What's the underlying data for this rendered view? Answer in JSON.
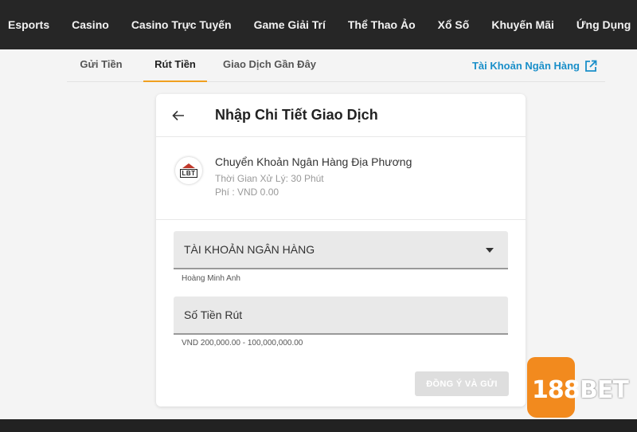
{
  "topnav": {
    "items": [
      "Esports",
      "Casino",
      "Casino Trực Tuyến",
      "Game Giải Trí",
      "Thể Thao Ảo",
      "Xổ Số",
      "Khuyến Mãi",
      "Ứng Dụng"
    ]
  },
  "subtabs": {
    "deposit": "Gửi Tiền",
    "withdraw": "Rút Tiền",
    "history": "Giao Dịch Gần Đây",
    "bank_account_link": "Tài Khoản Ngân Hàng"
  },
  "card": {
    "title": "Nhập Chi Tiết Giao Dịch",
    "method": {
      "logo_text": "LBT",
      "name": "Chuyển Khoản Ngân Hàng Địa Phương",
      "processing_time": "Thời Gian Xử Lý: 30 Phút",
      "fee": "Phí : VND 0.00"
    },
    "bank_select": {
      "label": "TÀI KHOẢN NGÂN HÀNG",
      "helper": "Hoàng Minh Anh"
    },
    "amount_input": {
      "placeholder": "Số Tiền Rút",
      "helper": "VND 200,000.00 - 100,000,000.00"
    },
    "submit_label": "ĐỒNG Ý VÀ GỬI"
  },
  "brand": {
    "num": "188",
    "word": "BET"
  }
}
